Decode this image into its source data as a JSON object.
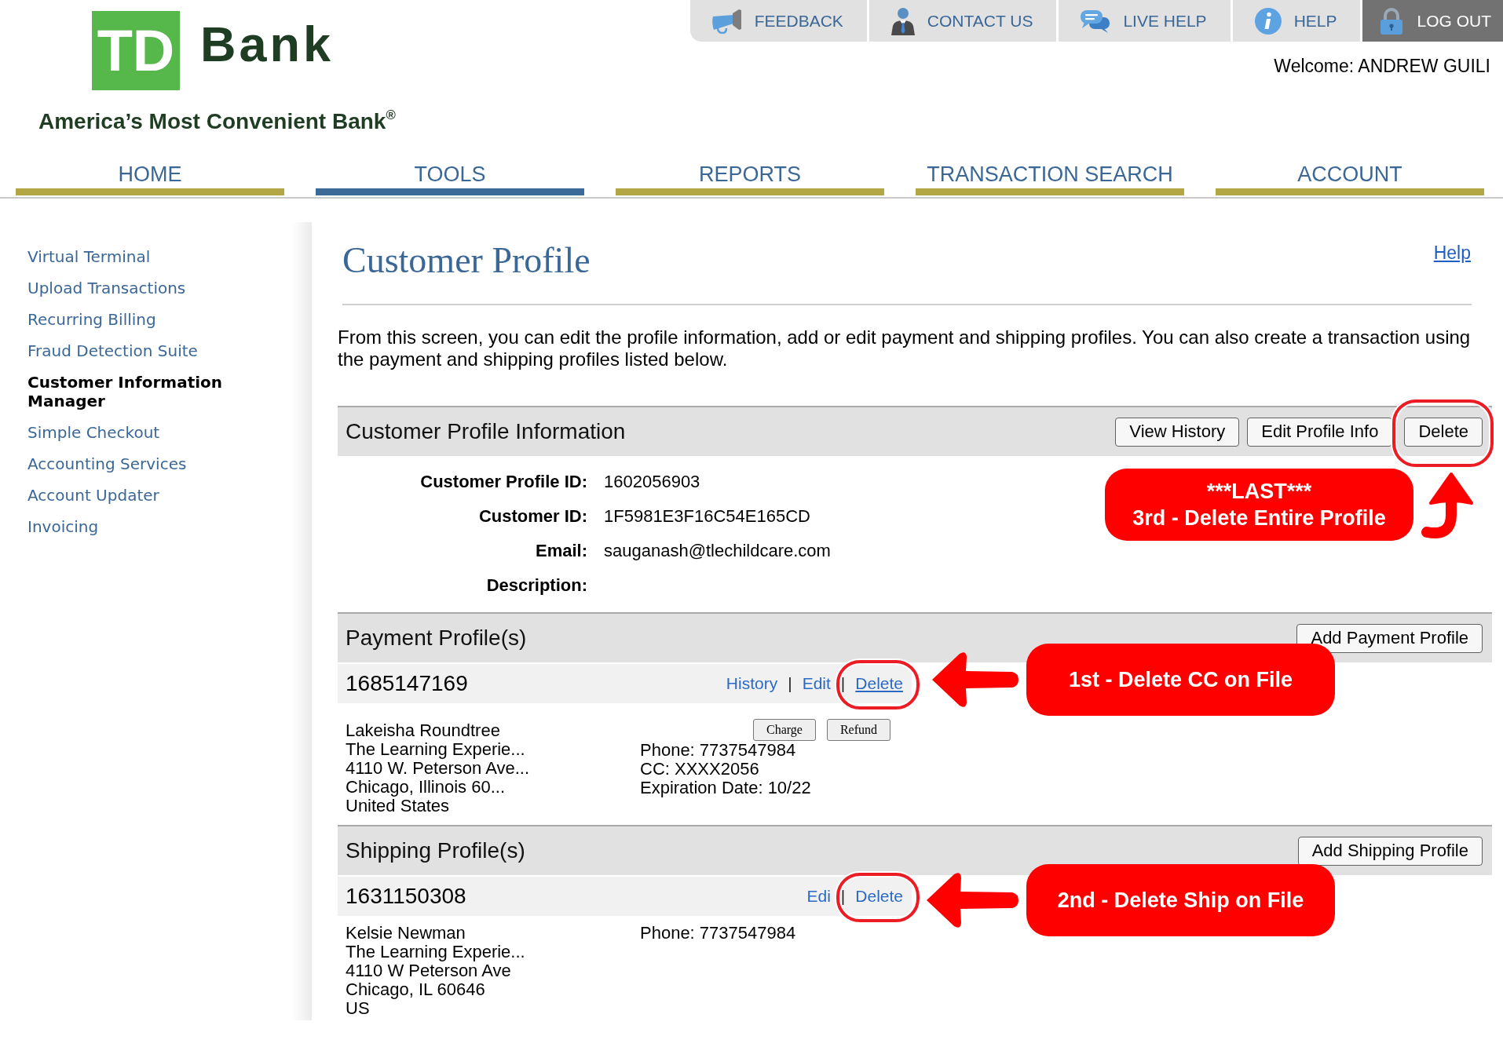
{
  "header": {
    "logo": {
      "mark": "TD",
      "name": "Bank",
      "tagline": "America’s Most Convenient Bank$^{®}$"
    },
    "utility_nav": [
      {
        "label": "FEEDBACK",
        "kind": "link"
      },
      {
        "label": "CONTACT US",
        "kind": "link"
      },
      {
        "label": "LIVE HELP",
        "kind": "link"
      },
      {
        "label": "HELP",
        "kind": "link"
      },
      {
        "label": "LOG OUT",
        "kind": "logout"
      }
    ],
    "welcome": "Welcome: ANDREW GUILI"
  },
  "nav": {
    "tabs": [
      {
        "label": "HOME",
        "selected": false
      },
      {
        "label": "TOOLS",
        "selected": true
      },
      {
        "label": "REPORTS",
        "selected": false
      },
      {
        "label": "TRANSACTION SEARCH",
        "selected": false
      },
      {
        "label": "ACCOUNT",
        "selected": false
      }
    ]
  },
  "sidebar": {
    "items": [
      {
        "label": "Virtual Terminal",
        "selected": false
      },
      {
        "label": "Upload Transactions",
        "selected": false
      },
      {
        "label": "Recurring Billing",
        "selected": false
      },
      {
        "label": "Fraud Detection Suite",
        "selected": false
      },
      {
        "label": "Customer Information Manager",
        "selected": true
      },
      {
        "label": "Simple Checkout",
        "selected": false
      },
      {
        "label": "Accounting Services",
        "selected": false
      },
      {
        "label": "Account Updater",
        "selected": false
      },
      {
        "label": "Invoicing",
        "selected": false
      }
    ]
  },
  "main": {
    "title": "Customer Profile",
    "help_link": "Help",
    "intro": "From this screen, you can edit the profile information, add or edit payment and shipping profiles. You can also create a transaction using the payment and shipping profiles listed below.",
    "sections": [
      {
        "kind": "details",
        "title": "Customer Profile Information",
        "buttons": [
          {
            "label": "View History",
            "circled": false
          },
          {
            "label": "Edit Profile Info",
            "circled": false
          },
          {
            "label": "Delete",
            "circled": true
          }
        ],
        "fields": [
          {
            "label": "Customer Profile ID:",
            "value": "1602056903"
          },
          {
            "label": "Customer ID:",
            "value": "1F5981E3F16C54E165CD"
          },
          {
            "label": "Email:",
            "value": "sauganash@tlechildcare.com"
          },
          {
            "label": "Description:"
          }
        ],
        "callout": {
          "kind": "up",
          "lines": [
            "***LAST***",
            "3rd - Delete Entire Profile"
          ]
        }
      },
      {
        "kind": "profiles",
        "title": "Payment Profile(s)",
        "buttons": [
          {
            "label": "Add Payment Profile",
            "circled": false
          }
        ],
        "profile": {
          "id": "1685147169",
          "actions": [
            {
              "kind": "link",
              "label": "History",
              "underlined": false,
              "circled": false
            },
            {
              "kind": "separator",
              "label": "|"
            },
            {
              "kind": "link",
              "label": "Edit",
              "underlined": false,
              "circled": false
            },
            {
              "kind": "separator",
              "label": "|"
            },
            {
              "kind": "link",
              "label": "Delete",
              "underlined": true,
              "circled": true
            }
          ],
          "buttons": [
            "Charge",
            "Refund"
          ],
          "address": [
            "Lakeisha Roundtree",
            "The Learning Experie...",
            "4110 W. Peterson Ave...",
            "Chicago, Illinois 60...",
            "United States"
          ],
          "details": [
            "Phone: 7737547984",
            "CC: XXXX2056",
            "Expiration Date: 10/22"
          ]
        },
        "callout": {
          "kind": "left",
          "lines": [
            "1st - Delete CC on File"
          ]
        }
      },
      {
        "kind": "profiles",
        "title": "Shipping Profile(s)",
        "buttons": [
          {
            "label": "Add Shipping Profile",
            "circled": false
          }
        ],
        "profile": {
          "id": "1631150308",
          "actions": [
            {
              "kind": "link",
              "label": "Edi",
              "underlined": false,
              "circled": false
            },
            {
              "kind": "separator",
              "label": "|"
            },
            {
              "kind": "link",
              "label": "Delete",
              "underlined": false,
              "circled": true
            }
          ],
          "address": [
            "Kelsie Newman",
            "The Learning Experie...",
            "4110 W Peterson Ave",
            "Chicago, IL 60646",
            "US"
          ],
          "details": [
            "Phone: 7737547984"
          ]
        },
        "callout": {
          "kind": "left",
          "lines": [
            "2nd - Delete Ship on File"
          ]
        }
      }
    ]
  }
}
